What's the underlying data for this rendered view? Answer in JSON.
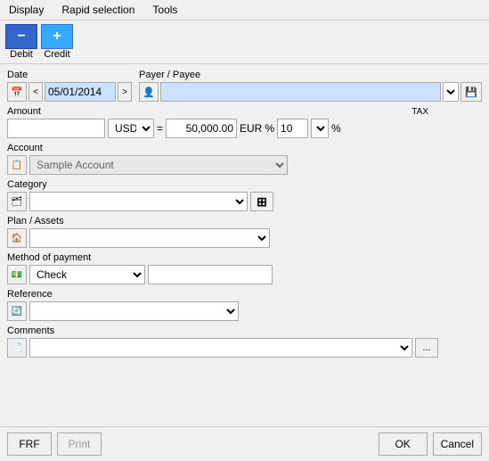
{
  "menubar": {
    "items": [
      "Display",
      "Rapid selection",
      "Tools"
    ]
  },
  "toolbar": {
    "debit_label": "Debit",
    "debit_icon": "−",
    "credit_label": "Credit",
    "credit_icon": "+"
  },
  "form": {
    "date_label": "Date",
    "date_value": "05/01/2014",
    "payer_label": "Payer / Payee",
    "payer_value": "",
    "amount_label": "Amount",
    "amount_usd_value": "",
    "currency_usd": "USD",
    "equals": "=",
    "amount_eur_value": "50,000.00",
    "currency_eur": "EUR",
    "tax_label": "TAX",
    "tax_percent_symbol": "%",
    "tax_value": "10",
    "tax_pct": "%",
    "account_label": "Account",
    "account_value": "Sample Account",
    "category_label": "Category",
    "category_value": "",
    "plan_label": "Plan / Assets",
    "plan_value": "",
    "payment_label": "Method of payment",
    "payment_value": "Check",
    "payment_extra": "",
    "reference_label": "Reference",
    "reference_value": "",
    "comments_label": "Comments",
    "comments_value": ""
  },
  "buttons": {
    "frf": "FRF",
    "print": "Print",
    "ok": "OK",
    "cancel": "Cancel"
  },
  "icons": {
    "calendar": "📅",
    "prev": "<",
    "next": ">",
    "payer_icon": "👤",
    "save_icon": "💾",
    "account_icon": "📋",
    "category_icon": "🗂",
    "plan_icon": "🏠",
    "payment_icon": "💵",
    "reference_icon": "🔄",
    "comments_icon": "📄",
    "split_icon": "⊞"
  }
}
